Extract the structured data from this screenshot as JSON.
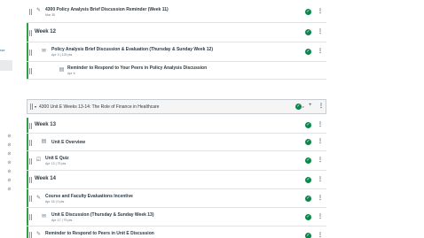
{
  "left_nav": {
    "fragment": "rse",
    "icons": [
      "eye-off-icon",
      "eye-off-icon",
      "eye-off-icon",
      "eye-off-icon",
      "eye-off-icon",
      "eye-off-icon",
      "eye-off-icon"
    ]
  },
  "top_module": {
    "items": [
      {
        "kind": "item",
        "type": "assignment-icon",
        "title": "4300 Policy Analysis Brief Discussion Reminder (Week 11)",
        "meta": "Mar 30",
        "indent": 0
      },
      {
        "kind": "subheader",
        "title": "Week 12"
      },
      {
        "kind": "item",
        "type": "discussion-icon",
        "title": "Policy Analysis Brief Discussion & Evaluation (Thursday & Sunday Week 12)",
        "meta": "Apr 3  |  125 pts",
        "indent": 1
      },
      {
        "kind": "item",
        "type": "page-icon",
        "title": "Reminder to Respond to Your Peers in Policy Analysis Discussion",
        "meta": "Apr 6",
        "indent": 2
      }
    ]
  },
  "module": {
    "title": "4300 Unit E Weeks 13-14: The Role of Finance in Healthcare",
    "items": [
      {
        "kind": "subheader",
        "title": "Week 13"
      },
      {
        "kind": "item",
        "type": "page-icon",
        "title": "Unit E Overview",
        "meta": "",
        "indent": 1
      },
      {
        "kind": "item",
        "type": "quiz-icon",
        "title": "Unit E Quiz",
        "meta": "Apr 13  |  75 pts",
        "indent": 1
      },
      {
        "kind": "subheader",
        "title": "Week 14"
      },
      {
        "kind": "item",
        "type": "assignment-icon",
        "title": "Course and Faculty Evaluations Incentive",
        "meta": "Apr 16  |  0 pts",
        "indent": 1
      },
      {
        "kind": "item",
        "type": "discussion-icon",
        "title": "Unit E Discussion (Thursday & Sunday Week 13)",
        "meta": "Apr 17  |  75 pts",
        "indent": 1
      },
      {
        "kind": "item",
        "type": "assignment-icon",
        "title": "Reminder to Respond to Peers in Unit E Discussion",
        "meta": "",
        "indent": 1
      }
    ]
  },
  "colors": {
    "published": "#0b874b",
    "completion_bar": "#2f9e44"
  }
}
